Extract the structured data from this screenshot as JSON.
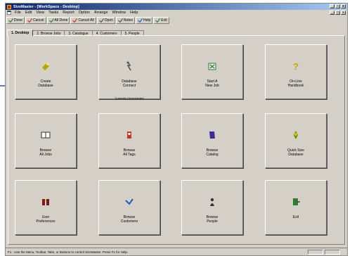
{
  "window": {
    "title": "SizeMaster - [WorkSpace - Desktop]"
  },
  "menu": [
    "File",
    "Edit",
    "View",
    "Tasks",
    "Report",
    "Option",
    "Arrange",
    "Window",
    "Help"
  ],
  "toolbar": [
    {
      "label": "Done",
      "icon": "done-icon",
      "color": "#2f7d32"
    },
    {
      "label": "Cancel",
      "icon": "cancel-icon",
      "color": "#c0392b"
    },
    {
      "label": "All Done",
      "icon": "all-done-icon",
      "color": "#2f7d32"
    },
    {
      "label": "Cancel All",
      "icon": "cancel-all-icon",
      "color": "#c0392b"
    },
    {
      "label": "Open",
      "icon": "open-icon",
      "color": "#555"
    },
    {
      "label": "Notes",
      "icon": "notes-icon",
      "color": "#555"
    },
    {
      "label": "Help",
      "icon": "help-icon",
      "color": "#1a5fb4"
    },
    {
      "label": "Exit",
      "icon": "exit-icon",
      "color": "#2f7d32"
    }
  ],
  "tabs": [
    "1. Desktop",
    "2. Browse Jobs",
    "3. Catalogue",
    "4. Customers",
    "5. People"
  ],
  "cards": [
    {
      "label": "Create\nDatabase",
      "icon": "create-database-icon",
      "color": "#b8a000"
    },
    {
      "label": "Database\nConnect",
      "icon": "database-connect-icon",
      "color": "#555",
      "sub": "Currently Unconnected"
    },
    {
      "label": "Start A\nNew Job",
      "icon": "new-job-icon",
      "color": "#2f7d32"
    },
    {
      "label": "On-Line\nHandbook",
      "icon": "handbook-icon",
      "color": "#c9a400"
    },
    {
      "label": "Browse\nAll Jobs",
      "icon": "browse-jobs-icon",
      "color": "#333"
    },
    {
      "label": "Browse\nAll Tags",
      "icon": "browse-tags-icon",
      "color": "#c0392b"
    },
    {
      "label": "Browse\nCatalog",
      "icon": "browse-catalog-icon",
      "color": "#3b2e9a"
    },
    {
      "label": "Quick Size\nDatabase",
      "icon": "quick-size-icon",
      "color": "#6a8a00"
    },
    {
      "label": "User\nPreferences",
      "icon": "user-preferences-icon",
      "color": "#7a1a1a"
    },
    {
      "label": "Browse\nCustomers",
      "icon": "browse-customers-icon",
      "color": "#1a5fb4"
    },
    {
      "label": "Browse\nPeople",
      "icon": "browse-people-icon",
      "color": "#333"
    },
    {
      "label": "Exit",
      "icon": "exit-app-icon",
      "color": "#2f7d32"
    }
  ],
  "status": {
    "text": "F1 - Use the Menu, Toolbar, Tabs, or Buttons to control SizeMaster.  Press F1 for Help."
  }
}
